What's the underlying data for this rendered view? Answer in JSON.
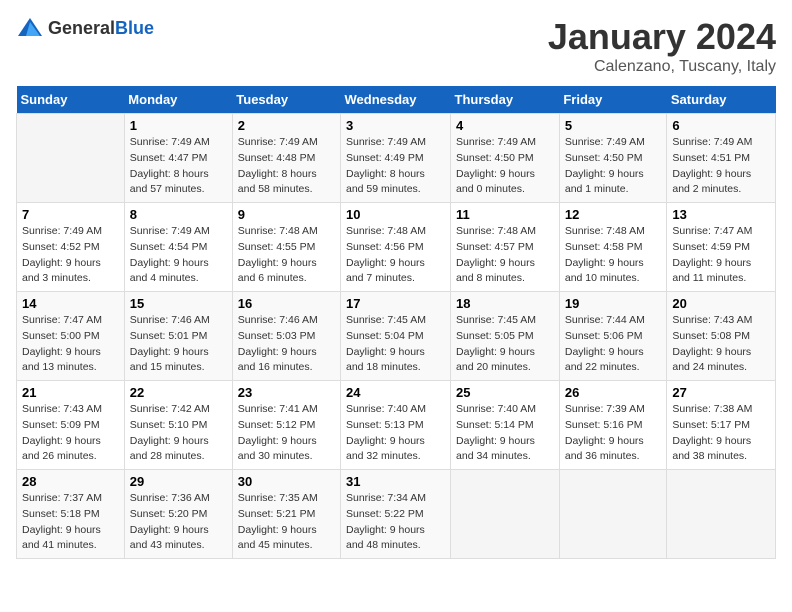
{
  "header": {
    "logo_general": "General",
    "logo_blue": "Blue",
    "month": "January 2024",
    "location": "Calenzano, Tuscany, Italy"
  },
  "days_of_week": [
    "Sunday",
    "Monday",
    "Tuesday",
    "Wednesday",
    "Thursday",
    "Friday",
    "Saturday"
  ],
  "weeks": [
    [
      {
        "num": "",
        "empty": true
      },
      {
        "num": "1",
        "sunrise": "Sunrise: 7:49 AM",
        "sunset": "Sunset: 4:47 PM",
        "daylight": "Daylight: 8 hours and 57 minutes."
      },
      {
        "num": "2",
        "sunrise": "Sunrise: 7:49 AM",
        "sunset": "Sunset: 4:48 PM",
        "daylight": "Daylight: 8 hours and 58 minutes."
      },
      {
        "num": "3",
        "sunrise": "Sunrise: 7:49 AM",
        "sunset": "Sunset: 4:49 PM",
        "daylight": "Daylight: 8 hours and 59 minutes."
      },
      {
        "num": "4",
        "sunrise": "Sunrise: 7:49 AM",
        "sunset": "Sunset: 4:50 PM",
        "daylight": "Daylight: 9 hours and 0 minutes."
      },
      {
        "num": "5",
        "sunrise": "Sunrise: 7:49 AM",
        "sunset": "Sunset: 4:50 PM",
        "daylight": "Daylight: 9 hours and 1 minute."
      },
      {
        "num": "6",
        "sunrise": "Sunrise: 7:49 AM",
        "sunset": "Sunset: 4:51 PM",
        "daylight": "Daylight: 9 hours and 2 minutes."
      }
    ],
    [
      {
        "num": "7",
        "sunrise": "Sunrise: 7:49 AM",
        "sunset": "Sunset: 4:52 PM",
        "daylight": "Daylight: 9 hours and 3 minutes."
      },
      {
        "num": "8",
        "sunrise": "Sunrise: 7:49 AM",
        "sunset": "Sunset: 4:54 PM",
        "daylight": "Daylight: 9 hours and 4 minutes."
      },
      {
        "num": "9",
        "sunrise": "Sunrise: 7:48 AM",
        "sunset": "Sunset: 4:55 PM",
        "daylight": "Daylight: 9 hours and 6 minutes."
      },
      {
        "num": "10",
        "sunrise": "Sunrise: 7:48 AM",
        "sunset": "Sunset: 4:56 PM",
        "daylight": "Daylight: 9 hours and 7 minutes."
      },
      {
        "num": "11",
        "sunrise": "Sunrise: 7:48 AM",
        "sunset": "Sunset: 4:57 PM",
        "daylight": "Daylight: 9 hours and 8 minutes."
      },
      {
        "num": "12",
        "sunrise": "Sunrise: 7:48 AM",
        "sunset": "Sunset: 4:58 PM",
        "daylight": "Daylight: 9 hours and 10 minutes."
      },
      {
        "num": "13",
        "sunrise": "Sunrise: 7:47 AM",
        "sunset": "Sunset: 4:59 PM",
        "daylight": "Daylight: 9 hours and 11 minutes."
      }
    ],
    [
      {
        "num": "14",
        "sunrise": "Sunrise: 7:47 AM",
        "sunset": "Sunset: 5:00 PM",
        "daylight": "Daylight: 9 hours and 13 minutes."
      },
      {
        "num": "15",
        "sunrise": "Sunrise: 7:46 AM",
        "sunset": "Sunset: 5:01 PM",
        "daylight": "Daylight: 9 hours and 15 minutes."
      },
      {
        "num": "16",
        "sunrise": "Sunrise: 7:46 AM",
        "sunset": "Sunset: 5:03 PM",
        "daylight": "Daylight: 9 hours and 16 minutes."
      },
      {
        "num": "17",
        "sunrise": "Sunrise: 7:45 AM",
        "sunset": "Sunset: 5:04 PM",
        "daylight": "Daylight: 9 hours and 18 minutes."
      },
      {
        "num": "18",
        "sunrise": "Sunrise: 7:45 AM",
        "sunset": "Sunset: 5:05 PM",
        "daylight": "Daylight: 9 hours and 20 minutes."
      },
      {
        "num": "19",
        "sunrise": "Sunrise: 7:44 AM",
        "sunset": "Sunset: 5:06 PM",
        "daylight": "Daylight: 9 hours and 22 minutes."
      },
      {
        "num": "20",
        "sunrise": "Sunrise: 7:43 AM",
        "sunset": "Sunset: 5:08 PM",
        "daylight": "Daylight: 9 hours and 24 minutes."
      }
    ],
    [
      {
        "num": "21",
        "sunrise": "Sunrise: 7:43 AM",
        "sunset": "Sunset: 5:09 PM",
        "daylight": "Daylight: 9 hours and 26 minutes."
      },
      {
        "num": "22",
        "sunrise": "Sunrise: 7:42 AM",
        "sunset": "Sunset: 5:10 PM",
        "daylight": "Daylight: 9 hours and 28 minutes."
      },
      {
        "num": "23",
        "sunrise": "Sunrise: 7:41 AM",
        "sunset": "Sunset: 5:12 PM",
        "daylight": "Daylight: 9 hours and 30 minutes."
      },
      {
        "num": "24",
        "sunrise": "Sunrise: 7:40 AM",
        "sunset": "Sunset: 5:13 PM",
        "daylight": "Daylight: 9 hours and 32 minutes."
      },
      {
        "num": "25",
        "sunrise": "Sunrise: 7:40 AM",
        "sunset": "Sunset: 5:14 PM",
        "daylight": "Daylight: 9 hours and 34 minutes."
      },
      {
        "num": "26",
        "sunrise": "Sunrise: 7:39 AM",
        "sunset": "Sunset: 5:16 PM",
        "daylight": "Daylight: 9 hours and 36 minutes."
      },
      {
        "num": "27",
        "sunrise": "Sunrise: 7:38 AM",
        "sunset": "Sunset: 5:17 PM",
        "daylight": "Daylight: 9 hours and 38 minutes."
      }
    ],
    [
      {
        "num": "28",
        "sunrise": "Sunrise: 7:37 AM",
        "sunset": "Sunset: 5:18 PM",
        "daylight": "Daylight: 9 hours and 41 minutes."
      },
      {
        "num": "29",
        "sunrise": "Sunrise: 7:36 AM",
        "sunset": "Sunset: 5:20 PM",
        "daylight": "Daylight: 9 hours and 43 minutes."
      },
      {
        "num": "30",
        "sunrise": "Sunrise: 7:35 AM",
        "sunset": "Sunset: 5:21 PM",
        "daylight": "Daylight: 9 hours and 45 minutes."
      },
      {
        "num": "31",
        "sunrise": "Sunrise: 7:34 AM",
        "sunset": "Sunset: 5:22 PM",
        "daylight": "Daylight: 9 hours and 48 minutes."
      },
      {
        "num": "",
        "empty": true
      },
      {
        "num": "",
        "empty": true
      },
      {
        "num": "",
        "empty": true
      }
    ]
  ]
}
